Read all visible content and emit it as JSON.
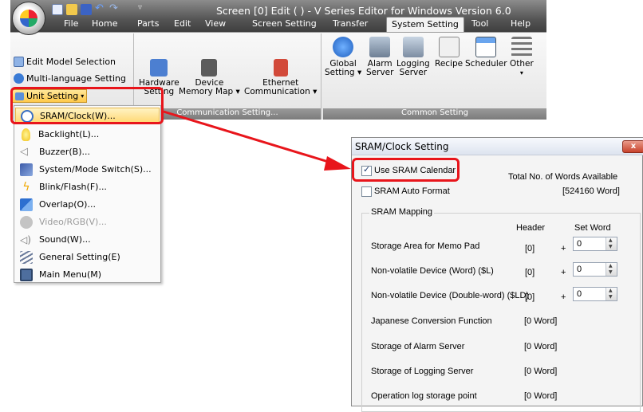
{
  "window": {
    "title": "Screen [0] Edit (         ) - V Series Editor for Windows Version 6.0"
  },
  "menu": {
    "tabs": [
      "File",
      "Home",
      "Parts",
      "Edit",
      "View",
      "Screen Setting",
      "Transfer",
      "System Setting",
      "Tool",
      "Help"
    ],
    "active_tab": "System Setting"
  },
  "ribbon": {
    "small_commands": [
      "Edit Model Selection",
      "Multi-language Setting",
      "Unit Setting"
    ],
    "unit_setting_label": "Unit Setting",
    "communication": {
      "hardware_line1": "Hardware",
      "hardware_line2": "Setting",
      "device_line1": "Device",
      "device_line2": "Memory Map",
      "ethernet_line1": "Ethernet",
      "ethernet_line2": "Communication",
      "group_label": "Communication Setting..."
    },
    "common": {
      "global_line1": "Global",
      "global_line2": "Setting",
      "alarm_line1": "Alarm",
      "alarm_line2": "Server",
      "logging_line1": "Logging",
      "logging_line2": "Server",
      "recipe": "Recipe",
      "scheduler": "Scheduler",
      "other": "Other",
      "group_label": "Common Setting"
    }
  },
  "dropdown": {
    "items": [
      {
        "label": "SRAM/Clock(W)...",
        "icon": "clock-icon"
      },
      {
        "label": "Backlight(L)...",
        "icon": "bulb-icon"
      },
      {
        "label": "Buzzer(B)...",
        "icon": "speaker-icon"
      },
      {
        "label": "System/Mode Switch(S)...",
        "icon": "switch-icon"
      },
      {
        "label": "Blink/Flash(F)...",
        "icon": "flash-icon"
      },
      {
        "label": "Overlap(O)...",
        "icon": "overlap-icon"
      },
      {
        "label": "Video/RGB(V)...",
        "icon": "video-icon"
      },
      {
        "label": "Sound(W)...",
        "icon": "sound-icon"
      },
      {
        "label": "General Setting(E)",
        "icon": "general-icon"
      },
      {
        "label": "Main Menu(M)",
        "icon": "main-menu-icon"
      }
    ]
  },
  "dialog": {
    "title": "SRAM/Clock Setting",
    "close": "x",
    "use_sram_calendar": {
      "label": "Use SRAM Calendar",
      "checked": true
    },
    "sram_auto_format": {
      "label": "SRAM Auto Format",
      "checked": false
    },
    "total_words_label": "Total No. of Words Available",
    "total_words_value": "[524160 Word]",
    "mapping_title": "SRAM Mapping",
    "col_header": "Header",
    "col_set_word": "Set Word",
    "rows": [
      {
        "label": "Storage Area for Memo Pad",
        "header": "[0]",
        "plus": "+",
        "value": "0"
      },
      {
        "label": "Non-volatile Device (Word) ($L)",
        "header": "[0]",
        "plus": "+",
        "value": "0"
      },
      {
        "label": "Non-volatile Device (Double-word) ($LD)",
        "header": "[0]",
        "plus": "+",
        "value": "0"
      }
    ],
    "info_rows": [
      {
        "label": "Japanese Conversion Function",
        "value": "[0 Word]"
      },
      {
        "label": "Storage of Alarm Server",
        "value": "[0 Word]"
      },
      {
        "label": "Storage of Logging Server",
        "value": "[0 Word]"
      },
      {
        "label": "Operation log storage point",
        "value": "[0 Word]"
      }
    ]
  }
}
